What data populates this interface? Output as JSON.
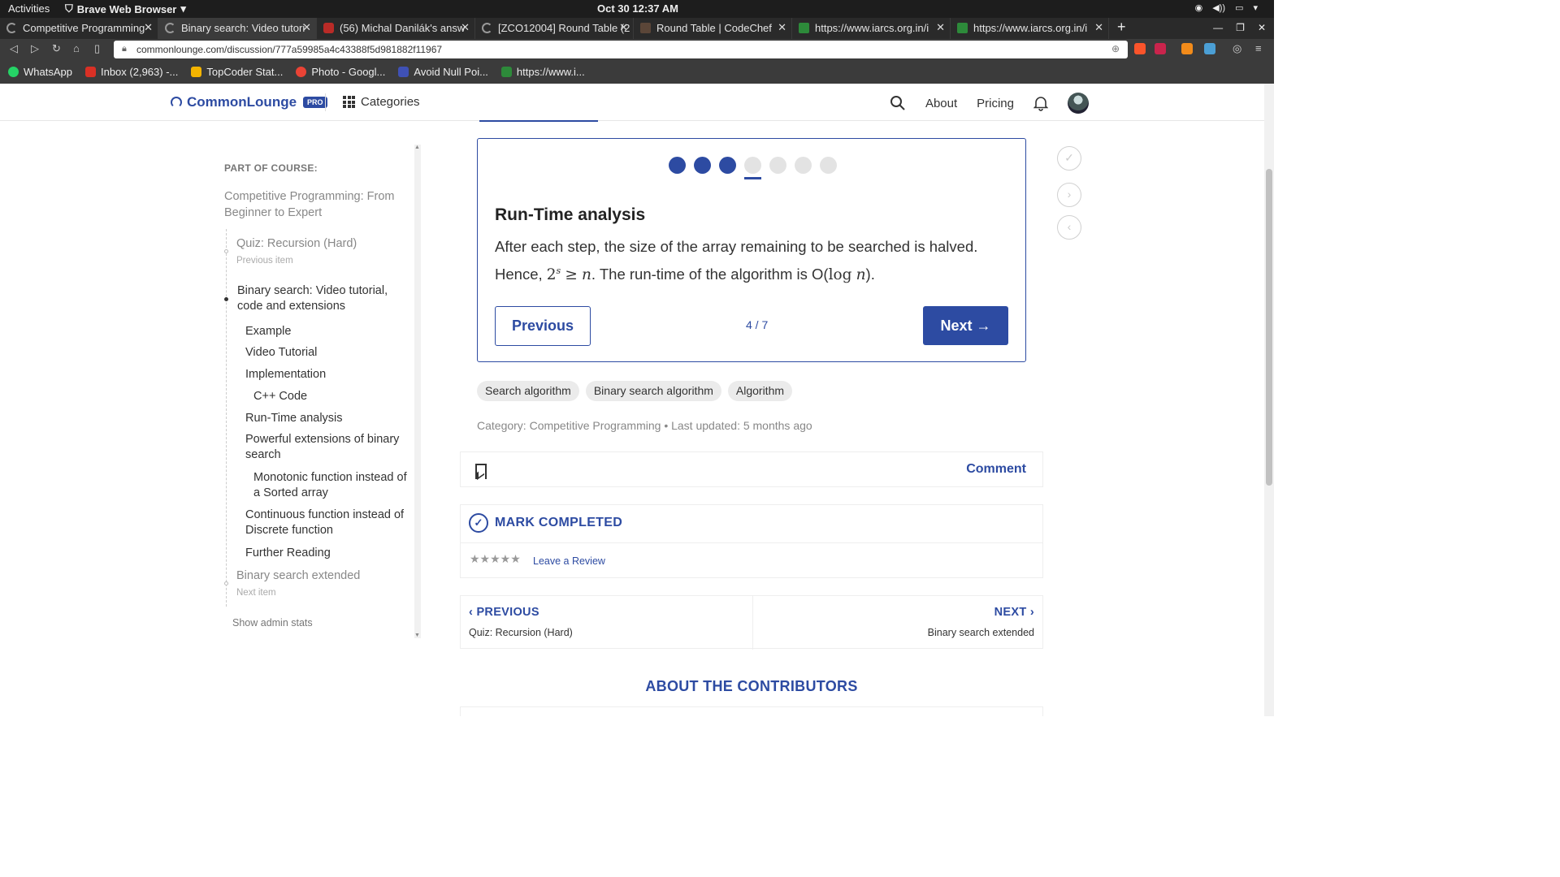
{
  "os": {
    "activities": "Activities",
    "app_name": "Brave Web Browser",
    "clock": "Oct 30  12:37 AM"
  },
  "browser": {
    "tabs": [
      {
        "label": "Competitive Programming",
        "favicon": "loading-icon"
      },
      {
        "label": "Binary search: Video tutori",
        "favicon": "loading-icon",
        "active": true
      },
      {
        "label": "(56) Michal Danilák's answ",
        "favicon": "quora-icon"
      },
      {
        "label": "[ZCO12004] Round Table (2",
        "favicon": "loading-icon"
      },
      {
        "label": "Round Table | CodeChef",
        "favicon": "codechef-icon"
      },
      {
        "label": "https://www.iarcs.org.in/i",
        "favicon": "iarcs-icon"
      },
      {
        "label": "https://www.iarcs.org.in/i",
        "favicon": "iarcs-icon"
      }
    ],
    "url": "commonlounge.com/discussion/777a59985a4c43388f5d981882f11967",
    "bookmarks": [
      {
        "label": "WhatsApp",
        "color": "#25d366"
      },
      {
        "label": "Inbox (2,963) -...",
        "color": "#d93025"
      },
      {
        "label": "TopCoder Stat...",
        "color": "#f4b400"
      },
      {
        "label": "Photo - Googl...",
        "color": "#ea4335"
      },
      {
        "label": "Avoid Null Poi...",
        "color": "#3f51b5"
      },
      {
        "label": "https://www.i...",
        "color": "#2d8a3a"
      }
    ]
  },
  "header": {
    "logo": "CommonLounge",
    "pro_badge": "PRO",
    "categories": "Categories",
    "about": "About",
    "pricing": "Pricing",
    "accent": "#2d4ba2"
  },
  "sidebar": {
    "label": "PART OF COURSE:",
    "course": "Competitive Programming: From Beginner to Expert",
    "previous_item": "Quiz: Recursion (Hard)",
    "previous_caption": "Previous item",
    "current_item": "Binary search: Video tutorial, code and extensions",
    "sections": [
      "Example",
      "Video Tutorial",
      "Implementation",
      "C++ Code",
      "Run-Time analysis",
      "Powerful extensions of binary search",
      "Monotonic function instead of a Sorted array",
      "Continuous function instead of Discrete function",
      "Further Reading"
    ],
    "next_item": "Binary search extended",
    "next_caption": "Next item",
    "admin": "Show admin stats"
  },
  "slide": {
    "progress": {
      "current": 4,
      "total": 7
    },
    "title": "Run-Time analysis",
    "body_prefix": "After each step, the size of the array remaining to be searched is halved. Hence,",
    "math_base": "2",
    "math_exp": "s",
    "math_rel": "≥",
    "math_var": "n",
    "body_mid": ". The run-time of the algorithm is O(",
    "math_log": "log",
    "math_log_var": "n",
    "body_end": ").",
    "previous": "Previous",
    "counter": "4 / 7",
    "next": "Next →"
  },
  "tags": [
    "Search algorithm",
    "Binary search algorithm",
    "Algorithm"
  ],
  "meta": {
    "category": "Category: Competitive Programming",
    "separator": "•",
    "updated": "Last updated: 5 months ago"
  },
  "actions": {
    "comment": "Comment",
    "mark_completed": "MARK COMPLETED",
    "stars": "★★★★★",
    "review": "Leave a Review"
  },
  "pager": {
    "previous_label": "‹ PREVIOUS",
    "previous_title": "Quiz: Recursion (Hard)",
    "next_label": "NEXT ›",
    "next_title": "Binary search extended"
  },
  "contributors": "ABOUT THE CONTRIBUTORS"
}
